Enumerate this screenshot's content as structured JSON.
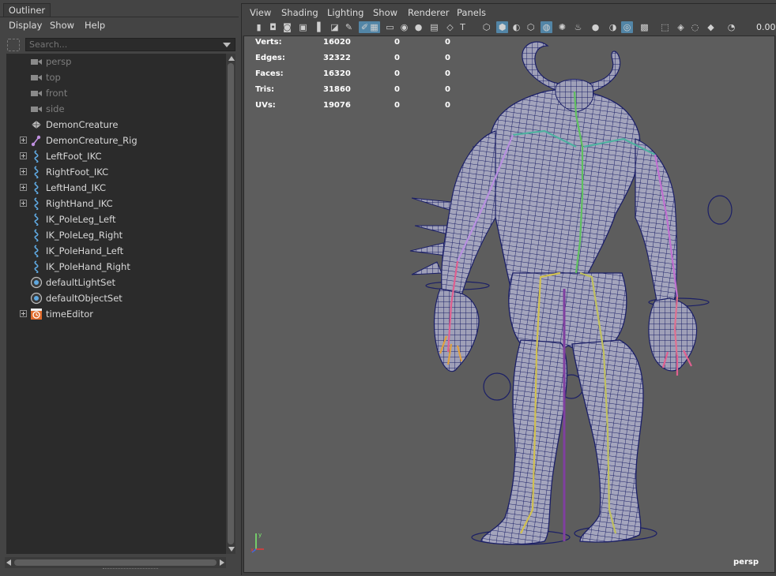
{
  "outliner": {
    "tab_label": "Outliner",
    "menu": [
      "Display",
      "Show",
      "Help"
    ],
    "search_placeholder": "Search...",
    "items": [
      {
        "label": "persp",
        "icon": "camera-icon",
        "expandable": false,
        "dim": true
      },
      {
        "label": "top",
        "icon": "camera-icon",
        "expandable": false,
        "dim": true
      },
      {
        "label": "front",
        "icon": "camera-icon",
        "expandable": false,
        "dim": true
      },
      {
        "label": "side",
        "icon": "camera-icon",
        "expandable": false,
        "dim": true
      },
      {
        "label": "DemonCreature",
        "icon": "mesh-icon",
        "expandable": false,
        "dim": false
      },
      {
        "label": "DemonCreature_Rig",
        "icon": "joint-icon",
        "expandable": true,
        "dim": false
      },
      {
        "label": "LeftFoot_IKC",
        "icon": "curve-icon",
        "expandable": true,
        "dim": false
      },
      {
        "label": "RightFoot_IKC",
        "icon": "curve-icon",
        "expandable": true,
        "dim": false
      },
      {
        "label": "LeftHand_IKC",
        "icon": "curve-icon",
        "expandable": true,
        "dim": false
      },
      {
        "label": "RightHand_IKC",
        "icon": "curve-icon",
        "expandable": true,
        "dim": false
      },
      {
        "label": "IK_PoleLeg_Left",
        "icon": "curve-icon",
        "expandable": false,
        "dim": false
      },
      {
        "label": "IK_PoleLeg_Right",
        "icon": "curve-icon",
        "expandable": false,
        "dim": false
      },
      {
        "label": "IK_PoleHand_Left",
        "icon": "curve-icon",
        "expandable": false,
        "dim": false
      },
      {
        "label": "IK_PoleHand_Right",
        "icon": "curve-icon",
        "expandable": false,
        "dim": false
      },
      {
        "label": "defaultLightSet",
        "icon": "set-icon",
        "expandable": false,
        "dim": false
      },
      {
        "label": "defaultObjectSet",
        "icon": "set-icon",
        "expandable": false,
        "dim": false
      },
      {
        "label": "timeEditor",
        "icon": "time-editor-icon",
        "expandable": true,
        "dim": false
      }
    ]
  },
  "viewport": {
    "menu": [
      "View",
      "Shading",
      "Lighting",
      "Show",
      "Renderer",
      "Panels"
    ],
    "zoom_value": "0.00",
    "camera_label": "persp",
    "hud": [
      {
        "label": "Verts:",
        "v1": "16020",
        "v2": "0",
        "v3": "0"
      },
      {
        "label": "Edges:",
        "v1": "32322",
        "v2": "0",
        "v3": "0"
      },
      {
        "label": "Faces:",
        "v1": "16320",
        "v2": "0",
        "v3": "0"
      },
      {
        "label": "Tris:",
        "v1": "31860",
        "v2": "0",
        "v3": "0"
      },
      {
        "label": "UVs:",
        "v1": "19076",
        "v2": "0",
        "v3": "0"
      }
    ],
    "toolbar_icons": [
      "camera-icon",
      "camera-select-icon",
      "camera-lock-icon",
      "camera-attr-icon",
      "bookmark-icon",
      "image-plane-icon",
      "grease-pencil-icon",
      "paint-icon",
      "grid-icon",
      "film-gate-icon",
      "resolution-gate-icon",
      "gate-mask-icon",
      "field-chart-icon",
      "safe-action-icon",
      "safe-title-icon",
      "wireframe-icon",
      "smooth-shade-icon",
      "default-material-icon",
      "wireframe-on-shaded-icon",
      "xray-icon",
      "use-all-lights-icon",
      "shadows-icon",
      "sphere-icon",
      "ambient-occlusion-icon",
      "motion-blur-icon",
      "antialias-icon",
      "isolate-select-icon",
      "xray-joints-icon",
      "xray-active-icon",
      "backface-cull-icon",
      "gamma-icon"
    ],
    "accent_color": "#5285a6",
    "mesh_color": "#1a1f66"
  }
}
